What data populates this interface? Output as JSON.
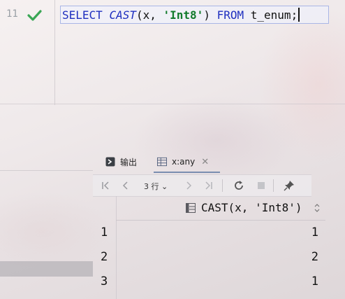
{
  "editor": {
    "line_number": "11",
    "code": {
      "kw_select": "SELECT",
      "fn_cast": "CAST",
      "open_paren": "(",
      "arg_x": "x",
      "comma": ", ",
      "arg_type": "'Int8'",
      "close_paren": ")",
      "kw_from": "FROM",
      "table": "t_enum;"
    }
  },
  "results": {
    "tabs": [
      {
        "label": "输出",
        "icon": "console-icon"
      },
      {
        "label": "x:any",
        "icon": "table-icon",
        "close": "✕"
      }
    ],
    "toolbar": {
      "rows_label": "3 行",
      "rows_dropdown": "⌄"
    },
    "column_header": "CAST(x, 'Int8')",
    "rows": [
      {
        "num": "1",
        "value": "1"
      },
      {
        "num": "2",
        "value": "2"
      },
      {
        "num": "3",
        "value": "1"
      }
    ]
  },
  "colors": {
    "keyword": "#1f2fbf",
    "string": "#117a2b",
    "success": "#3aa655"
  }
}
